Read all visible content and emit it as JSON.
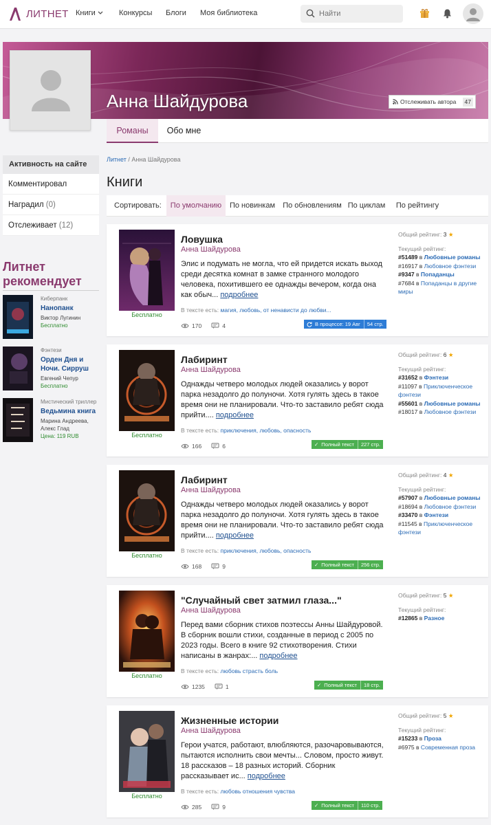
{
  "nav": {
    "logo": "ЛИТНЕТ",
    "links": [
      "Книги",
      "Конкурсы",
      "Блоги",
      "Моя библиотека"
    ],
    "search_placeholder": "Найти"
  },
  "profile": {
    "name": "Анна Шайдурова",
    "follow_label": "Отслеживать автора",
    "follow_count": "47",
    "tabs": [
      "Романы",
      "Обо мне"
    ]
  },
  "sidebar": {
    "activity_title": "Активность на сайте",
    "items": [
      {
        "label": "Комментировал",
        "count": ""
      },
      {
        "label": "Наградил",
        "count": "(0)"
      },
      {
        "label": "Отслеживает",
        "count": "(12)"
      }
    ],
    "rec_title": "Литнет рекомендует",
    "recs": [
      {
        "genre": "Киберпанк",
        "title": "Нанопанк",
        "author": "Виктор Лугинин",
        "price": "Бесплатно"
      },
      {
        "genre": "Фэнтези",
        "title": "Орден Дня и Ночи. Сирруш",
        "author": "Евгений Чепур",
        "price": "Бесплатно"
      },
      {
        "genre": "Мистический триллер",
        "title": "Ведьмина книга",
        "author": "Марина Андреева, Алекс Глад",
        "price": "Цена: 119 RUB"
      }
    ]
  },
  "main": {
    "breadcrumb": {
      "root": "Литнет",
      "current": "Анна Шайдурова"
    },
    "heading": "Книги",
    "sort_label": "Сортировать:",
    "sort_options": [
      "По умолчанию",
      "По новинкам",
      "По обновлениям",
      "По циклам",
      "По рейтингу"
    ]
  },
  "books": [
    {
      "title": "Ловушка",
      "author": "Анна Шайдурова",
      "desc": "Элис и подумать не могла, что ей придется искать выход среди десятка комнат в замке странного молодого человека, похитившего ее однажды вечером, когда она как обыч...",
      "more": "подробнее",
      "free": "Бесплатно",
      "tags_label": "В тексте есть:",
      "tags": "магия, любовь, от ненависти до любви...",
      "views": "170",
      "comments": "4",
      "status": "В процессе: 19 Авг",
      "pages": "54 стр.",
      "overall_label": "Общий рейтинг:",
      "overall": "3",
      "current_label": "Текущий рейтинг:",
      "ranks": [
        {
          "pos": "#51489",
          "in": "в",
          "cat": "Любовные романы",
          "bold": true
        },
        {
          "pos": "#16917",
          "in": "в",
          "cat": "Любовное фэнтези",
          "bold": false
        },
        {
          "pos": "#9347",
          "in": "в",
          "cat": "Попаданцы",
          "bold": true
        },
        {
          "pos": "#7684",
          "in": "в",
          "cat": "Попаданцы в другие миры",
          "bold": false
        }
      ]
    },
    {
      "title": "Лабиринт",
      "author": "Анна Шайдурова",
      "desc": "Однажды четверо молодых людей оказались у ворот парка незадолго до полуночи. Хотя гулять здесь в такое время они не планировали. Что-то заставило ребят сюда прийти....",
      "more": "подробнее",
      "free": "Бесплатно",
      "tags_label": "В тексте есть:",
      "tags": "приключения, любовь, опасность",
      "views": "166",
      "comments": "6",
      "status": "Полный текст",
      "pages": "227 стр.",
      "overall_label": "Общий рейтинг:",
      "overall": "6",
      "current_label": "Текущий рейтинг:",
      "ranks": [
        {
          "pos": "#31652",
          "in": "в",
          "cat": "Фэнтези",
          "bold": true
        },
        {
          "pos": "#11097",
          "in": "в",
          "cat": "Приключенческое фэнтези",
          "bold": false
        },
        {
          "pos": "#55601",
          "in": "в",
          "cat": "Любовные романы",
          "bold": true
        },
        {
          "pos": "#18017",
          "in": "в",
          "cat": "Любовное фэнтези",
          "bold": false
        }
      ]
    },
    {
      "title": "Лабиринт",
      "author": "Анна Шайдурова",
      "desc": "Однажды четверо молодых людей оказались у ворот парка незадолго до полуночи. Хотя гулять здесь в такое время они не планировали. Что-то заставило ребят сюда прийти....",
      "more": "подробнее",
      "free": "Бесплатно",
      "tags_label": "В тексте есть:",
      "tags": "приключения, любовь, опасность",
      "views": "168",
      "comments": "9",
      "status": "Полный текст",
      "pages": "256 стр.",
      "overall_label": "Общий рейтинг:",
      "overall": "4",
      "current_label": "Текущий рейтинг:",
      "ranks": [
        {
          "pos": "#57907",
          "in": "в",
          "cat": "Любовные романы",
          "bold": true
        },
        {
          "pos": "#18694",
          "in": "в",
          "cat": "Любовное фэнтези",
          "bold": false
        },
        {
          "pos": "#33470",
          "in": "в",
          "cat": "Фэнтези",
          "bold": true
        },
        {
          "pos": "#11545",
          "in": "в",
          "cat": "Приключенческое фэнтези",
          "bold": false
        }
      ]
    },
    {
      "title": "\"Случайный свет затмил глаза...\"",
      "author": "Анна Шайдурова",
      "desc": "Перед вами сборник стихов поэтессы Анны Шайдуровой. В сборник вошли стихи, созданные в период с 2005 по 2023 годы. Всего в книге 92 стихотворения. Стихи написаны в жанрах:...",
      "more": "подробнее",
      "free": "Бесплатно",
      "tags_label": "В тексте есть:",
      "tags": "любовь страсть боль",
      "views": "1235",
      "comments": "1",
      "status": "Полный текст",
      "pages": "18 стр.",
      "overall_label": "Общий рейтинг:",
      "overall": "5",
      "current_label": "Текущий рейтинг:",
      "ranks": [
        {
          "pos": "#12865",
          "in": "в",
          "cat": "Разное",
          "bold": true
        }
      ]
    },
    {
      "title": "Жизненные истории",
      "author": "Анна Шайдурова",
      "desc": "Герои учатся, работают, влюбляются, разочаровываются, пытаются исполнить свои мечты... Словом, просто живут. 18 рассказов – 18 разных историй. Сборник рассказывает ис...",
      "more": "подробнее",
      "free": "Бесплатно",
      "tags_label": "В тексте есть:",
      "tags": "любовь отношения чувства",
      "views": "285",
      "comments": "9",
      "status": "Полный текст",
      "pages": "110 стр.",
      "overall_label": "Общий рейтинг:",
      "overall": "5",
      "current_label": "Текущий рейтинг:",
      "ranks": [
        {
          "pos": "#15233",
          "in": "в",
          "cat": "Проза",
          "bold": true
        },
        {
          "pos": "#6975",
          "in": "в",
          "cat": "Современная проза",
          "bold": false
        }
      ]
    }
  ],
  "colors": {
    "brand": "#8a3a6e",
    "link": "#2b6bb5",
    "free": "#2e8b2e",
    "status_process": "#2d7cd6",
    "status_full": "#4caf50"
  },
  "icons": [
    "logo-icon",
    "chevron-down-icon",
    "search-icon",
    "gift-icon",
    "bell-icon",
    "user-avatar-icon",
    "rss-icon",
    "eye-icon",
    "comments-icon",
    "star-icon",
    "refresh-icon",
    "check-icon"
  ]
}
